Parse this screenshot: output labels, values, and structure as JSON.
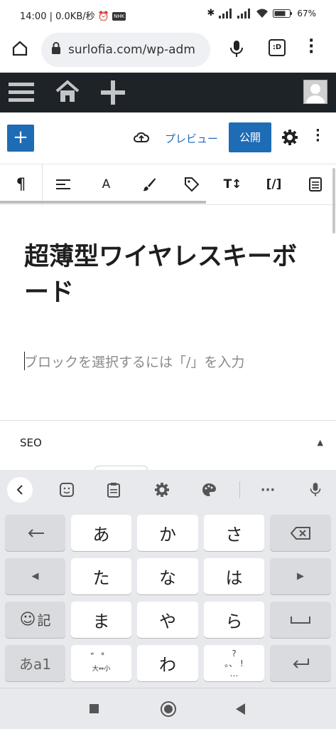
{
  "status": {
    "time": "14:00",
    "net": "0.0KB/秒",
    "battery": "67"
  },
  "browser": {
    "url": "surlofia.com/wp-adm"
  },
  "editor": {
    "preview_label": "プレビュー",
    "publish_label": "公開",
    "title": "超薄型ワイヤレスキーボード",
    "placeholder": "ブロックを選択するには「/」を入力"
  },
  "toolbar": {
    "items": [
      "¶",
      "",
      "A",
      "",
      "",
      "T↕",
      "[/]",
      ""
    ]
  },
  "panel": {
    "seo_label": "SEO"
  },
  "keyboard": {
    "row1": [
      "あ",
      "か",
      "さ"
    ],
    "row2": [
      "た",
      "な",
      "は"
    ],
    "row3": [
      "ま",
      "や",
      "ら"
    ],
    "row4_mid": "わ",
    "mode_label": "あa1",
    "emoji_label": "記",
    "dakuten_sub": "大⇔小",
    "punct_top": "?",
    "punct_bottom": "…",
    "punct_right": "!"
  },
  "colors": {
    "accent": "#1e6cb5",
    "adminbar": "#1d2327",
    "keyboard_bg": "#e8e9ec"
  }
}
